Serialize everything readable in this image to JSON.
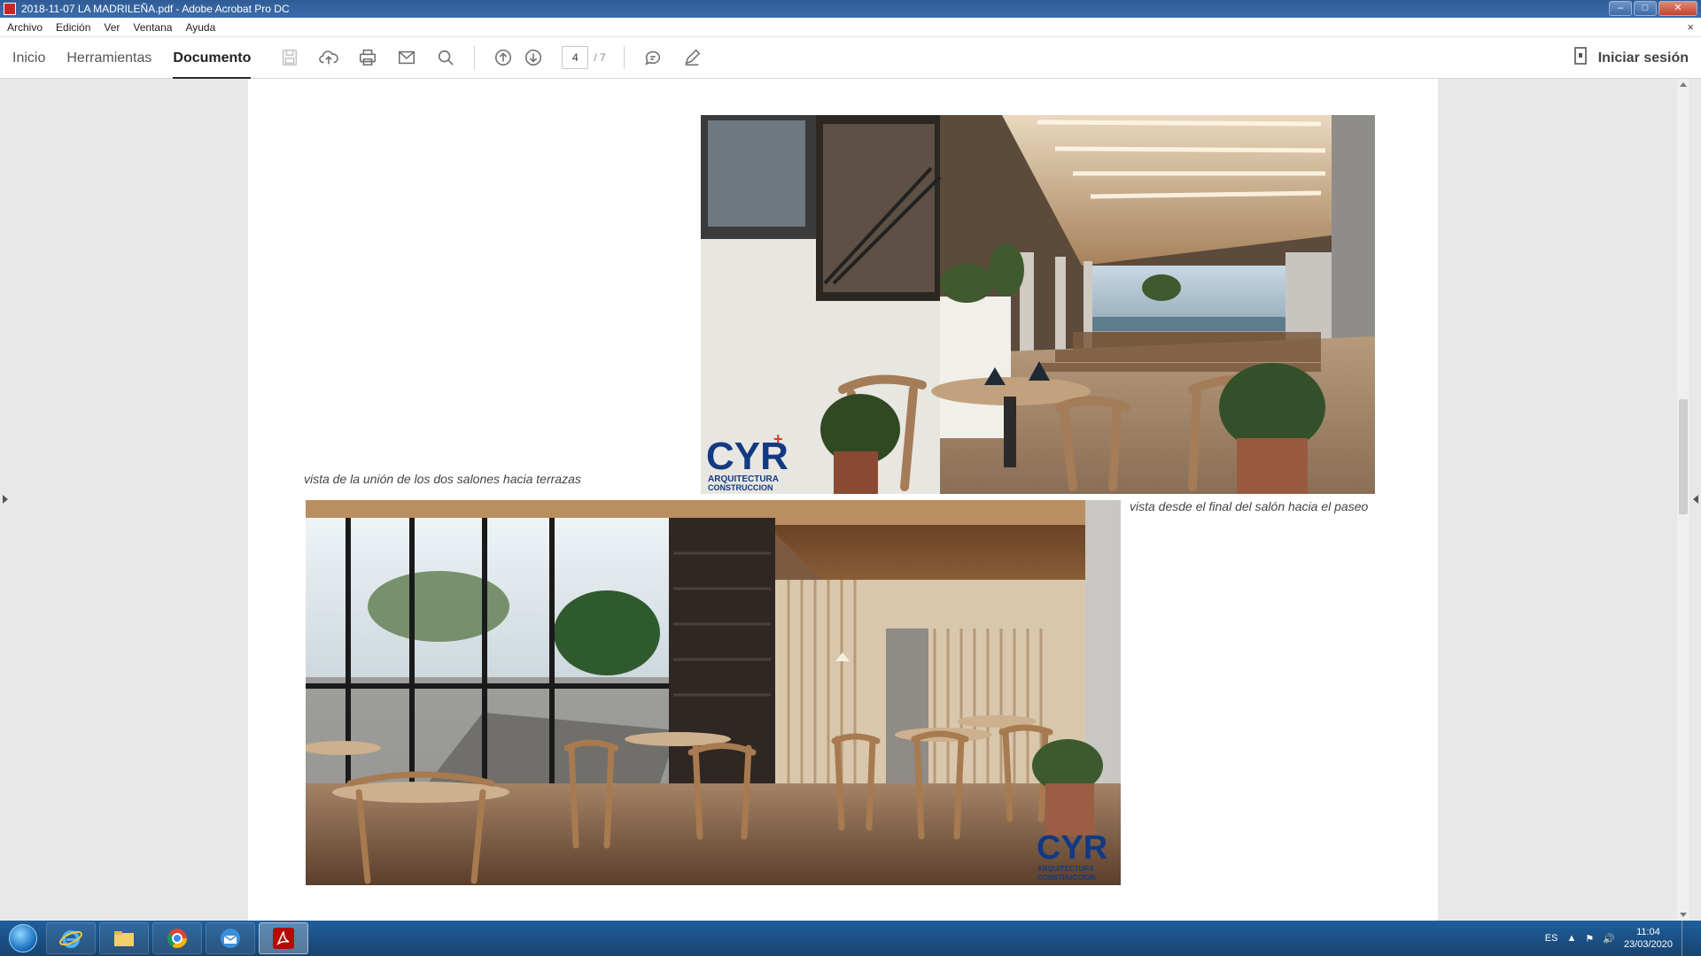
{
  "window": {
    "title": "2018-11-07 LA MADRILEÑA.pdf - Adobe Acrobat Pro DC",
    "minimize": "–",
    "maximize": "□",
    "close": "✕"
  },
  "menubar": {
    "items": [
      "Archivo",
      "Edición",
      "Ver",
      "Ventana",
      "Ayuda"
    ],
    "close": "×"
  },
  "toolbar": {
    "tabs": [
      {
        "label": "Inicio",
        "active": false
      },
      {
        "label": "Herramientas",
        "active": false
      },
      {
        "label": "Documento",
        "active": true
      }
    ],
    "icons": [
      "save-icon",
      "upload-icon",
      "print-icon",
      "mail-icon",
      "search-icon",
      "page-up-icon",
      "page-down-icon",
      "comment-icon",
      "pen-icon"
    ],
    "page_current": "4",
    "page_total": "/ 7",
    "signin_label": "Iniciar sesión"
  },
  "document": {
    "caption_top": "vista de la unión de los dos salones hacia terrazas",
    "caption_bottom": "vista desde el final del salón hacia el paseo",
    "logo_text": "CYR",
    "logo_sub1": "ARQUITECTURA",
    "logo_sub2": "CONSTRUCCION"
  },
  "taskbar": {
    "apps": [
      "internet-explorer-icon",
      "folder-icon",
      "chrome-icon",
      "outlook-icon",
      "acrobat-icon"
    ],
    "language": "ES",
    "time": "11:04",
    "date": "23/03/2020"
  },
  "colors": {
    "titlebar": "#2f5c95",
    "taskbar": "#1f5f9d",
    "acrobat_red": "#c9262c"
  }
}
